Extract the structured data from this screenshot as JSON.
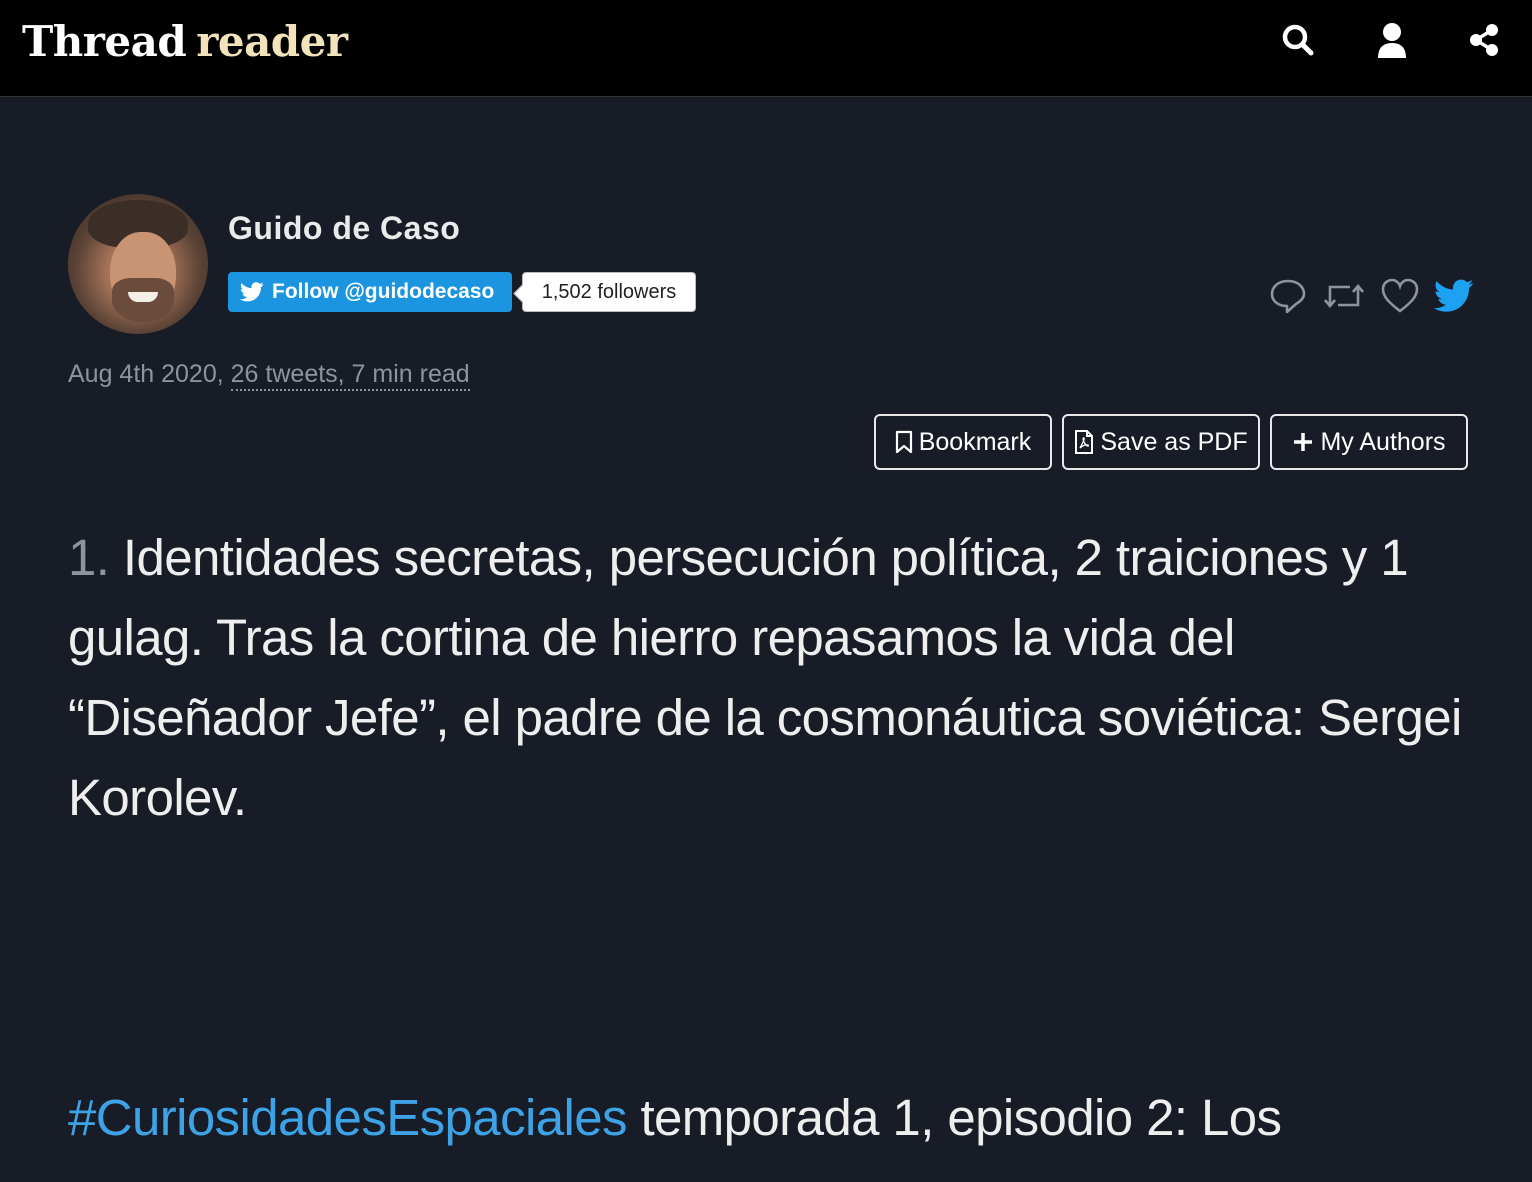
{
  "header": {
    "brand_left": "Thread",
    "brand_right": "reader",
    "icons": [
      "search-icon",
      "user-icon",
      "share-icon"
    ]
  },
  "author": {
    "name": "Guido de Caso",
    "follow_label": "Follow @guidodecaso",
    "followers": "1,502 followers"
  },
  "meta": {
    "date": "Aug 4th 2020,",
    "stats": "26 tweets, 7 min read"
  },
  "actions": {
    "bookmark": "Bookmark",
    "save_pdf": "Save as PDF",
    "my_authors": "My Authors"
  },
  "tweets": [
    {
      "number": "1.",
      "text": "Identidades secretas, persecución política, 2 traiciones y 1 gulag. Tras la cortina de hierro repasamos la vida del “Diseñador Jefe”, el padre de la cosmonáutica soviética: Sergei Korolev."
    },
    {
      "hashtag": "#CuriosidadesEspaciales",
      "text": "temporada 1, episodio 2: Los"
    }
  ],
  "colors": {
    "background": "#171c27",
    "topbar": "#000000",
    "brand_accent": "#f3e3bb",
    "twitter_blue": "#1b95e0",
    "hashtag": "#3da3e6",
    "muted": "#8f949c"
  }
}
